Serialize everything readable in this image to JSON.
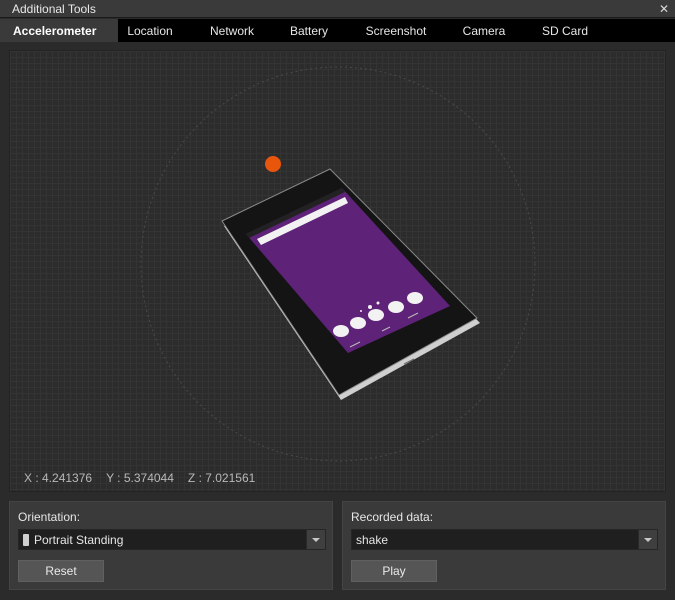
{
  "window": {
    "title": "Additional Tools",
    "close_icon": "close-icon"
  },
  "tabs": [
    {
      "label": "Accelerometer",
      "active": true
    },
    {
      "label": "Location"
    },
    {
      "label": "Network"
    },
    {
      "label": "Battery"
    },
    {
      "label": "Screenshot"
    },
    {
      "label": "Camera"
    },
    {
      "label": "SD Card"
    }
  ],
  "accelerometer": {
    "x_text": "X : 4.241376",
    "y_text": "Y : 5.374044",
    "z_text": "Z : 7.021561"
  },
  "orientation": {
    "label": "Orientation:",
    "selected": "Portrait Standing",
    "icon": "phone-icon",
    "reset_label": "Reset"
  },
  "recorded": {
    "label": "Recorded data:",
    "selected": "shake",
    "play_label": "Play"
  },
  "colors": {
    "accent_dot": "#e8560c",
    "screen_purple": "#5e2278",
    "tab_active_bg": "#3a3a3a",
    "tab_bar_bg": "#000000"
  }
}
